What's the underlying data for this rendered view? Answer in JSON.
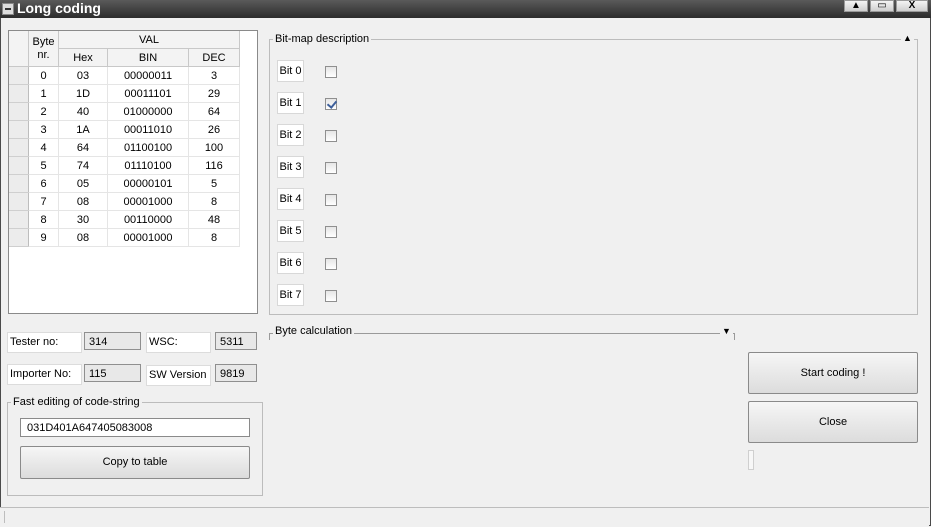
{
  "window": {
    "title": "Long coding"
  },
  "grid": {
    "header_byte": "Byte",
    "header_nr": "nr.",
    "header_val": "VAL",
    "col_hex": "Hex",
    "col_bin": "BIN",
    "col_dec": "DEC",
    "rows": [
      {
        "byte": "0",
        "hex": "03",
        "bin": "00000011",
        "dec": "3"
      },
      {
        "byte": "1",
        "hex": "1D",
        "bin": "00011101",
        "dec": "29"
      },
      {
        "byte": "2",
        "hex": "40",
        "bin": "01000000",
        "dec": "64"
      },
      {
        "byte": "3",
        "hex": "1A",
        "bin": "00011010",
        "dec": "26"
      },
      {
        "byte": "4",
        "hex": "64",
        "bin": "01100100",
        "dec": "100"
      },
      {
        "byte": "5",
        "hex": "74",
        "bin": "01110100",
        "dec": "116"
      },
      {
        "byte": "6",
        "hex": "05",
        "bin": "00000101",
        "dec": "5"
      },
      {
        "byte": "7",
        "hex": "08",
        "bin": "00001000",
        "dec": "8"
      },
      {
        "byte": "8",
        "hex": "30",
        "bin": "00110000",
        "dec": "48"
      },
      {
        "byte": "9",
        "hex": "08",
        "bin": "00001000",
        "dec": "8"
      }
    ]
  },
  "info": {
    "tester_label": "Tester no:",
    "tester_value": "314",
    "wsc_label": "WSC:",
    "wsc_value": "5311",
    "importer_label": "Importer No:",
    "importer_value": "115",
    "sw_label": "SW Version",
    "sw_value": "9819"
  },
  "fast_edit": {
    "title": "Fast editing of code-string",
    "value": "031D401A647405083008",
    "copy_label": "Copy to table"
  },
  "bitmap": {
    "title": "Bit-map description",
    "bits": [
      {
        "label": "Bit 0",
        "checked": false
      },
      {
        "label": "Bit 1",
        "checked": true
      },
      {
        "label": "Bit 2",
        "checked": false
      },
      {
        "label": "Bit 3",
        "checked": false
      },
      {
        "label": "Bit 4",
        "checked": false
      },
      {
        "label": "Bit 5",
        "checked": false
      },
      {
        "label": "Bit 6",
        "checked": false
      },
      {
        "label": "Bit 7",
        "checked": false
      }
    ]
  },
  "byte_calc": {
    "title": "Byte calculation"
  },
  "actions": {
    "start_label": "Start coding !",
    "close_label": "Close"
  },
  "icons": {
    "minimize": "triangle-up-icon",
    "restore": "restore-icon",
    "close": "close-icon"
  }
}
